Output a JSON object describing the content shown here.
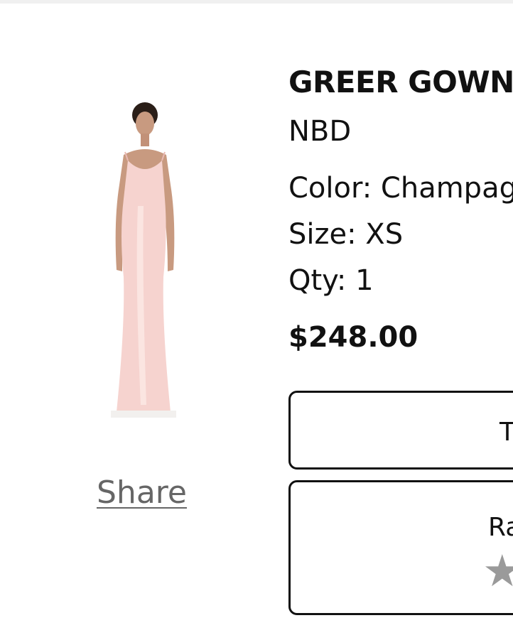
{
  "product": {
    "title": "GREER GOWN",
    "brand": "NBD",
    "color_line": "Color: Champagne",
    "size_line": "Size: XS",
    "qty_line": "Qty: 1",
    "price": "$248.00",
    "image_icon": "dress-photo",
    "image_colors": {
      "dress": "#f6d3cf",
      "skin": "#c89a80",
      "hair": "#2a1e18"
    }
  },
  "share": {
    "label": "Share"
  },
  "actions": {
    "primary_label": "T",
    "rating_label": "Ra",
    "star_icon": "star-icon"
  }
}
